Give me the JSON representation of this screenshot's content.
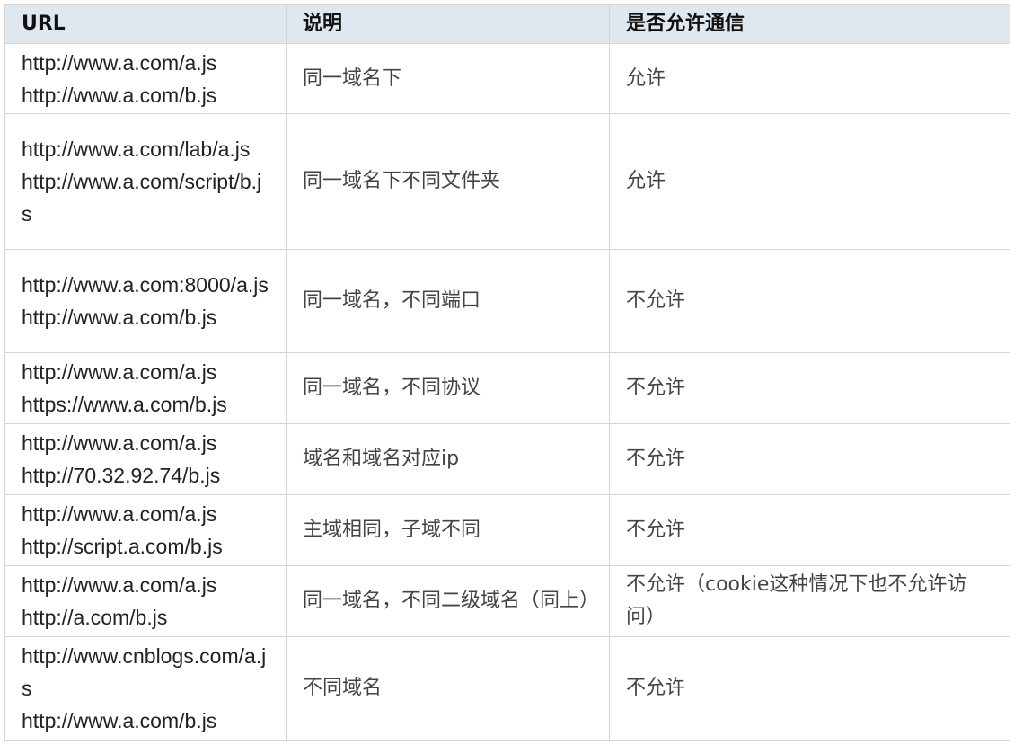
{
  "table": {
    "headers": [
      "URL",
      "说明",
      "是否允许通信"
    ],
    "rows": [
      {
        "urls": [
          "http://www.a.com/a.js",
          "http://www.a.com/b.js"
        ],
        "desc": "同一域名下",
        "allow": "允许"
      },
      {
        "urls": [
          "http://www.a.com/lab/a.js",
          "http://www.a.com/script/b.js"
        ],
        "desc": "同一域名下不同文件夹",
        "allow": "允许"
      },
      {
        "urls": [
          "http://www.a.com:8000/a.js",
          "http://www.a.com/b.js"
        ],
        "desc": "同一域名，不同端口",
        "allow": "不允许"
      },
      {
        "urls": [
          "http://www.a.com/a.js",
          "https://www.a.com/b.js"
        ],
        "desc": "同一域名，不同协议",
        "allow": "不允许"
      },
      {
        "urls": [
          "http://www.a.com/a.js",
          "http://70.32.92.74/b.js"
        ],
        "desc": "域名和域名对应ip",
        "allow": "不允许"
      },
      {
        "urls": [
          "http://www.a.com/a.js",
          "http://script.a.com/b.js"
        ],
        "desc": "主域相同，子域不同",
        "allow": "不允许"
      },
      {
        "urls": [
          "http://www.a.com/a.js",
          "http://a.com/b.js"
        ],
        "desc": "同一域名，不同二级域名（同上）",
        "allow": "不允许（cookie这种情况下也不允许访问）"
      },
      {
        "urls": [
          "http://www.cnblogs.com/a.js",
          "http://www.a.com/b.js"
        ],
        "desc": "不同域名",
        "allow": "不允许"
      }
    ]
  }
}
